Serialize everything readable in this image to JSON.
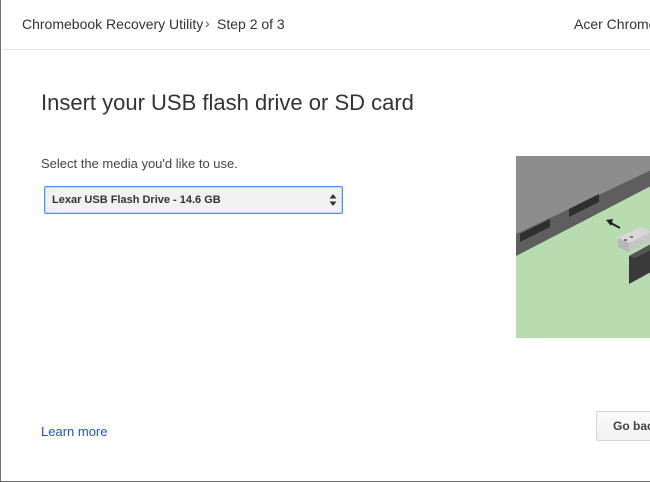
{
  "header": {
    "app_title": "Chromebook Recovery Utility",
    "separator": "›",
    "step": "Step 2 of 3",
    "device": "Acer Chrome"
  },
  "main": {
    "title": "Insert your USB flash drive or SD card",
    "prompt": "Select the media you'd like to use.",
    "media_select": {
      "selected": "Lexar USB Flash Drive - 14.6 GB"
    },
    "illustration": "usb-insertion-illustration"
  },
  "footer": {
    "learn_more": "Learn more",
    "go_back": "Go back"
  },
  "colors": {
    "link": "#1a56c9",
    "focus_border": "#4d90fe",
    "illustration_green": "#b8dcb0",
    "laptop_gray": "#8c8c8c"
  }
}
